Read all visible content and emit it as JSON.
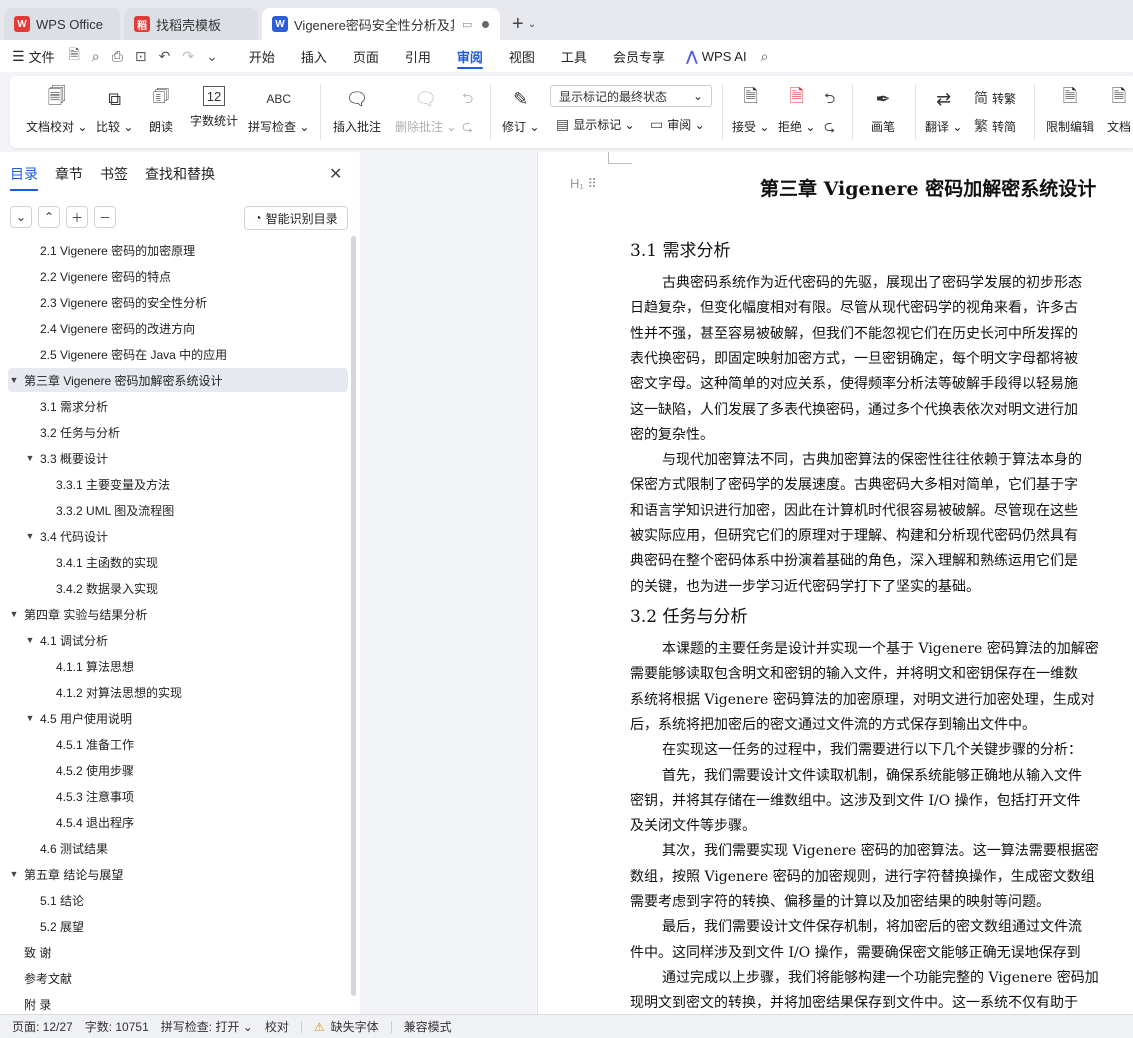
{
  "tabs": [
    {
      "label": "WPS Office",
      "logo": "W",
      "color": "#e53935"
    },
    {
      "label": "找稻壳模板",
      "logo": "稻",
      "color": "#e53935"
    },
    {
      "label": "Vigenere密码安全性分析及其",
      "logo": "W",
      "color": "#2b5fd9"
    }
  ],
  "menu": {
    "file_label": "文件",
    "items": [
      "开始",
      "插入",
      "页面",
      "引用",
      "审阅",
      "视图",
      "工具",
      "会员专享"
    ],
    "active": "审阅",
    "ai_label": "WPS AI"
  },
  "ribbon": {
    "doc_check": "文档校对",
    "compare": "比较",
    "read_aloud": "朗读",
    "word_count": "字数统计",
    "spell_check": "拼写检查",
    "insert_comment": "插入批注",
    "delete_comment": "删除批注",
    "revise": "修订",
    "markup_state": "显示标记的最终状态",
    "show_markup": "显示标记",
    "review": "审阅",
    "accept": "接受",
    "reject": "拒绝",
    "ink": "画笔",
    "translate": "翻译",
    "to_traditional": "转繁",
    "to_simplified": "转简",
    "restrict_edit": "限制编辑",
    "doc_partial": "文档"
  },
  "panel": {
    "tabs": [
      "目录",
      "章节",
      "书签",
      "查找和替换"
    ],
    "smart_toc": "智能识别目录",
    "toc": [
      {
        "label": "2.1 Vigenere 密码的加密原理",
        "level": 2,
        "expand": ""
      },
      {
        "label": "2.2 Vigenere 密码的特点",
        "level": 2,
        "expand": ""
      },
      {
        "label": "2.3 Vigenere 密码的安全性分析",
        "level": 2,
        "expand": ""
      },
      {
        "label": "2.4 Vigenere 密码的改进方向",
        "level": 2,
        "expand": ""
      },
      {
        "label": "2.5 Vigenere 密码在 Java 中的应用",
        "level": 2,
        "expand": ""
      },
      {
        "label": "第三章  Vigenere 密码加解密系统设计",
        "level": 1,
        "expand": "▼",
        "selected": true
      },
      {
        "label": "3.1 需求分析",
        "level": 2,
        "expand": ""
      },
      {
        "label": "3.2 任务与分析",
        "level": 2,
        "expand": ""
      },
      {
        "label": "3.3 概要设计",
        "level": 2,
        "expand": "▼"
      },
      {
        "label": "3.3.1 主要变量及方法",
        "level": 3,
        "expand": ""
      },
      {
        "label": "3.3.2 UML 图及流程图",
        "level": 3,
        "expand": ""
      },
      {
        "label": "3.4  代码设计",
        "level": 2,
        "expand": "▼"
      },
      {
        "label": "3.4.1 主函数的实现",
        "level": 3,
        "expand": ""
      },
      {
        "label": "3.4.2 数据录入实现",
        "level": 3,
        "expand": ""
      },
      {
        "label": "第四章  实验与结果分析",
        "level": 1,
        "expand": "▼"
      },
      {
        "label": "4.1  调试分析",
        "level": 2,
        "expand": "▼"
      },
      {
        "label": "4.1.1  算法思想",
        "level": 3,
        "expand": ""
      },
      {
        "label": "4.1.2 对算法思想的实现",
        "level": 3,
        "expand": ""
      },
      {
        "label": "4.5 用户使用说明",
        "level": 2,
        "expand": "▼"
      },
      {
        "label": "4.5.1 准备工作",
        "level": 3,
        "expand": ""
      },
      {
        "label": "4.5.2 使用步骤",
        "level": 3,
        "expand": ""
      },
      {
        "label": "4.5.3 注意事项",
        "level": 3,
        "expand": ""
      },
      {
        "label": "4.5.4 退出程序",
        "level": 3,
        "expand": ""
      },
      {
        "label": "4.6 测试结果",
        "level": 2,
        "expand": ""
      },
      {
        "label": "第五章  结论与展望",
        "level": 1,
        "expand": "▼"
      },
      {
        "label": "5.1 结论",
        "level": 2,
        "expand": ""
      },
      {
        "label": "5.2 展望",
        "level": 2,
        "expand": ""
      },
      {
        "label": "致    谢",
        "level": 1,
        "expand": ""
      },
      {
        "label": "参考文献",
        "level": 1,
        "expand": ""
      },
      {
        "label": "附    录",
        "level": 1,
        "expand": ""
      }
    ]
  },
  "doc": {
    "heading_mark": "H₁",
    "chapter_title": "第三章  Vigenere 密码加解密系统设计",
    "sec1_title": "3.1 需求分析",
    "sec1_lines": [
      "古典密码系统作为近代密码的先驱，展现出了密码学发展的初步形态",
      "日趋复杂，但变化幅度相对有限。尽管从现代密码学的视角来看，许多古",
      "性并不强，甚至容易被破解，但我们不能忽视它们在历史长河中所发挥的",
      "表代换密码，即固定映射加密方式，一旦密钥确定，每个明文字母都将被",
      "密文字母。这种简单的对应关系，使得频率分析法等破解手段得以轻易施",
      "这一缺陷，人们发展了多表代换密码，通过多个代换表依次对明文进行加",
      "密的复杂性。",
      "与现代加密算法不同，古典加密算法的保密性往往依赖于算法本身的",
      "保密方式限制了密码学的发展速度。古典密码大多相对简单，它们基于字",
      "和语言学知识进行加密，因此在计算机时代很容易被破解。尽管现在这些",
      "被实际应用，但研究它们的原理对于理解、构建和分析现代密码仍然具有",
      "典密码在整个密码体系中扮演着基础的角色，深入理解和熟练运用它们是",
      "的关键，也为进一步学习近代密码学打下了坚实的基础。"
    ],
    "sec2_title": "3.2 任务与分析",
    "sec2_lines": [
      "本课题的主要任务是设计并实现一个基于 Vigenere 密码算法的加解密",
      "需要能够读取包含明文和密钥的输入文件，并将明文和密钥保存在一维数",
      "系统将根据 Vigenere 密码算法的加密原理，对明文进行加密处理，生成对",
      "后，系统将把加密后的密文通过文件流的方式保存到输出文件中。",
      "在实现这一任务的过程中，我们需要进行以下几个关键步骤的分析：",
      "首先，我们需要设计文件读取机制，确保系统能够正确地从输入文件",
      "密钥，并将其存储在一维数组中。这涉及到文件 I/O 操作，包括打开文件",
      "及关闭文件等步骤。",
      "其次，我们需要实现 Vigenere 密码的加密算法。这一算法需要根据密",
      "数组，按照 Vigenere 密码的加密规则，进行字符替换操作，生成密文数组",
      "需要考虑到字符的转换、偏移量的计算以及加密结果的映射等问题。",
      "最后，我们需要设计文件保存机制，将加密后的密文数组通过文件流",
      "件中。这同样涉及到文件 I/O 操作，需要确保密文能够正确无误地保存到",
      "通过完成以上步骤，我们将能够构建一个功能完整的 Vigenere 密码加",
      "现明文到密文的转换，并将加密结果保存到文件中。这一系统不仅有助于"
    ]
  },
  "status": {
    "page": "页面: 12/27",
    "words": "字数: 10751",
    "spell": "拼写检查: 打开",
    "proof": "校对",
    "missing_font": "缺失字体",
    "compat": "兼容模式"
  }
}
